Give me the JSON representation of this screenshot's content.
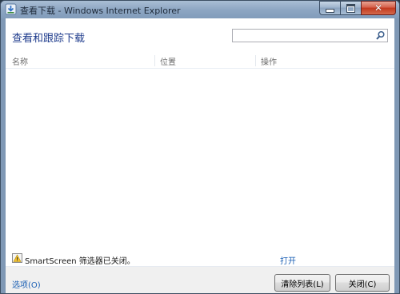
{
  "window": {
    "title": "查看下载 - Windows Internet Explorer",
    "app_icon": "ie-download-icon"
  },
  "caption": {
    "minimize_icon": "minimize-icon",
    "maximize_icon": "maximize-icon",
    "close_icon": "close-icon"
  },
  "header": {
    "title": "查看和跟踪下载",
    "search": {
      "value": "",
      "placeholder": "",
      "icon": "search-icon"
    }
  },
  "columns": [
    "名称",
    "位置",
    "操作"
  ],
  "smartscreen": {
    "icon": "shield-warning-icon",
    "text": "SmartScreen 筛选器已关闭。",
    "action": "打开"
  },
  "footer": {
    "options": "选项(O)",
    "clear_button": "清除列表(L)",
    "close_button": "关闭(C)"
  },
  "colors": {
    "title_blue": "#1e3b8c",
    "link_blue": "#1a5fb4",
    "close_red": "#c2381e"
  }
}
